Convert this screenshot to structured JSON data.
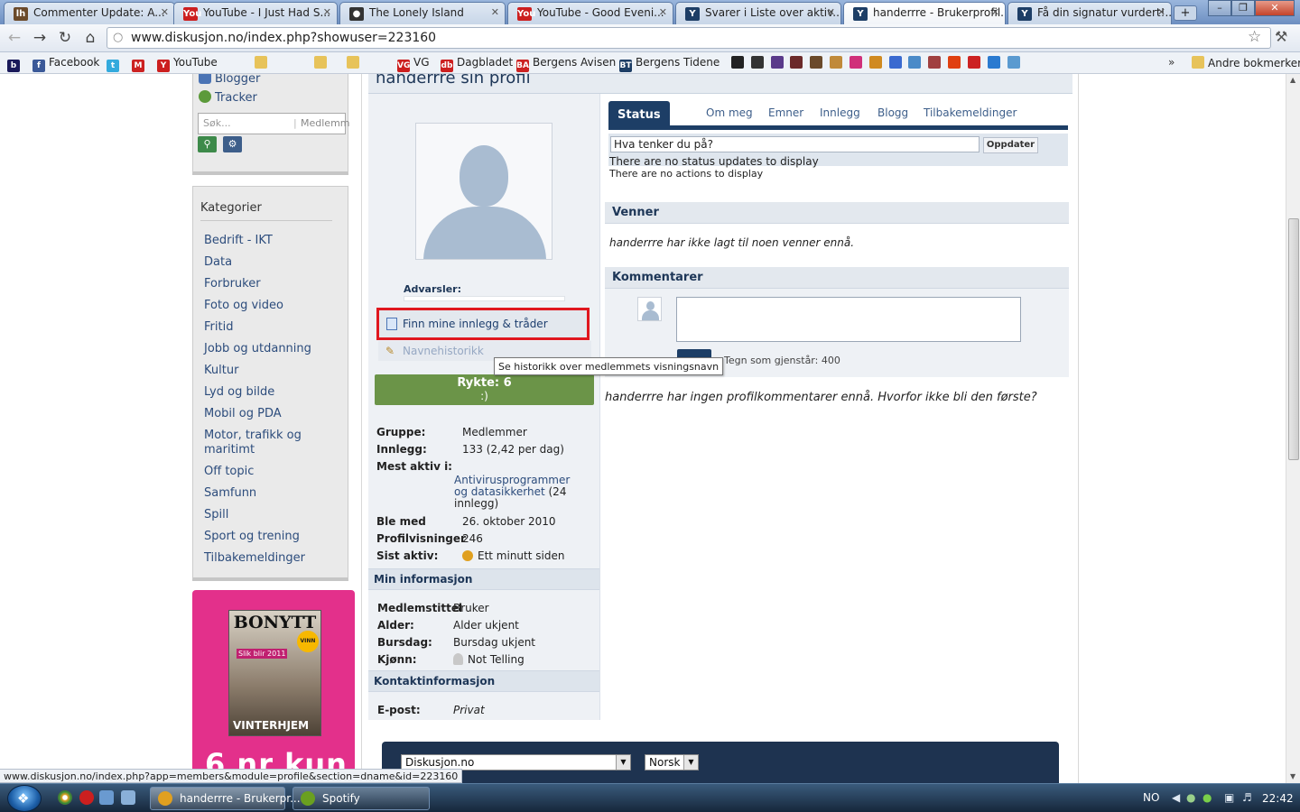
{
  "browser": {
    "tabs": [
      {
        "label": "Commenter Update: A...",
        "fav": "lh",
        "color": "#6b4a2a"
      },
      {
        "label": "YouTube - I Just Had S...",
        "fav": "You",
        "color": "#cc1f1f"
      },
      {
        "label": "The Lonely Island",
        "fav": "●",
        "color": "#333333"
      },
      {
        "label": "YouTube - Good Eveni...",
        "fav": "You",
        "color": "#cc1f1f"
      },
      {
        "label": "Svarer i Liste over aktiv...",
        "fav": "Y",
        "color": "#1d3e66"
      },
      {
        "label": "handerrre - Brukerprofil...",
        "fav": "Y",
        "color": "#1d3e66"
      },
      {
        "label": "Få din signatur vurdert!...",
        "fav": "Y",
        "color": "#1d3e66"
      }
    ],
    "url": "www.diskusjon.no/index.php?showuser=223160",
    "bookmarks": [
      {
        "label": "",
        "icon": "b",
        "color": "#1a1a5a"
      },
      {
        "label": "Facebook",
        "icon": "f",
        "color": "#3b5998"
      },
      {
        "label": "",
        "icon": "t",
        "color": "#33aadd"
      },
      {
        "label": "",
        "icon": "M",
        "color": "#cc2222"
      },
      {
        "label": "YouTube",
        "icon": "Y",
        "color": "#cc1f1f"
      },
      {
        "label": "VG",
        "icon": "VG",
        "color": "#cc1f1f"
      },
      {
        "label": "Dagbladet",
        "icon": "db",
        "color": "#cc1f1f"
      },
      {
        "label": "Bergens Avisen",
        "icon": "BA",
        "color": "#cc2222"
      },
      {
        "label": "Bergens Tidene",
        "icon": "BT",
        "color": "#1d3e66"
      }
    ],
    "other_bookmarks": "Andre bokmerker",
    "status_link": "www.diskusjon.no/index.php?app=members&module=profile&section=dname&id=223160"
  },
  "sidebar": {
    "links": [
      {
        "label": "Blogger",
        "color": "#4b74b5"
      },
      {
        "label": "Tracker",
        "color": "#5c9a3a"
      }
    ],
    "search_placeholder": "Søk...",
    "search_scope": "Medlemm",
    "categories_title": "Kategorier",
    "categories": [
      "Bedrift - IKT",
      "Data",
      "Forbruker",
      "Foto og video",
      "Fritid",
      "Jobb og utdanning",
      "Kultur",
      "Lyd og bilde",
      "Mobil og PDA",
      "Motor, trafikk og maritimt",
      "Off topic",
      "Samfunn",
      "Spill",
      "Sport og trening",
      "Tilbakemeldinger"
    ]
  },
  "ad": {
    "magazine": "BONYTT",
    "badge": "VINN",
    "subtitle": "Slik blir 2011",
    "bottom": "VINTERHJEM",
    "promo": "6 nr kun"
  },
  "profile": {
    "title": "handerrre sin profil",
    "warnings_label": "Advarsler:",
    "find_posts": "Finn mine innlegg & tråder",
    "name_history": "Navnehistorikk",
    "tooltip": "Se historikk over medlemmets visningsnavn",
    "reputation": "Rykte: 6",
    "reputation_smiley": ":)",
    "fields": [
      {
        "k": "Gruppe:",
        "v": "Medlemmer"
      },
      {
        "k": "Innlegg:",
        "v": "133 (2,42 per dag)"
      },
      {
        "k": "Mest aktiv i:",
        "v": ""
      },
      {
        "k": "Ble med",
        "v": "26. oktober 2010"
      },
      {
        "k": "Profilvisninger",
        "v": "246"
      },
      {
        "k": "Sist aktiv:",
        "v": "Ett minutt siden"
      }
    ],
    "most_active_link": "Antivirusprogrammer og datasikkerhet",
    "most_active_count": "(24 innlegg)",
    "my_info_title": "Min informasjon",
    "my_info": [
      {
        "k": "Medlemstittel",
        "v": "Bruker"
      },
      {
        "k": "Alder:",
        "v": "Alder ukjent"
      },
      {
        "k": "Bursdag:",
        "v": "Bursdag ukjent"
      },
      {
        "k": "Kjønn:",
        "v": "Not Telling"
      }
    ],
    "contact_title": "Kontaktinformasjon",
    "email_label": "E-post:",
    "email_value": "Privat"
  },
  "main": {
    "tabs": [
      "Status",
      "Om meg",
      "Emner",
      "Innlegg",
      "Blogg",
      "Tilbakemeldinger"
    ],
    "status_input": "Hva tenker du på?",
    "update_button": "Oppdater",
    "no_status": "There are no status updates to display",
    "no_actions": "There are no actions to display",
    "friends_title": "Venner",
    "friends_text": "handerrre har ikke lagt til noen venner ennå.",
    "comments_title": "Kommentarer",
    "chars_left": "Tegn som gjenstår: 400",
    "no_comments": "handerrre har ingen profilkommentarer ennå. Hvorfor ikke bli den første?"
  },
  "footer": {
    "site_select": "Diskusjon.no",
    "lang_select": "Norsk"
  },
  "taskbar": {
    "items": [
      {
        "label": "handerrre - Brukerpr...",
        "color": "#e0a020"
      },
      {
        "label": "Spotify",
        "color": "#6aa020"
      }
    ],
    "lang": "NO",
    "clock": "22:42"
  }
}
